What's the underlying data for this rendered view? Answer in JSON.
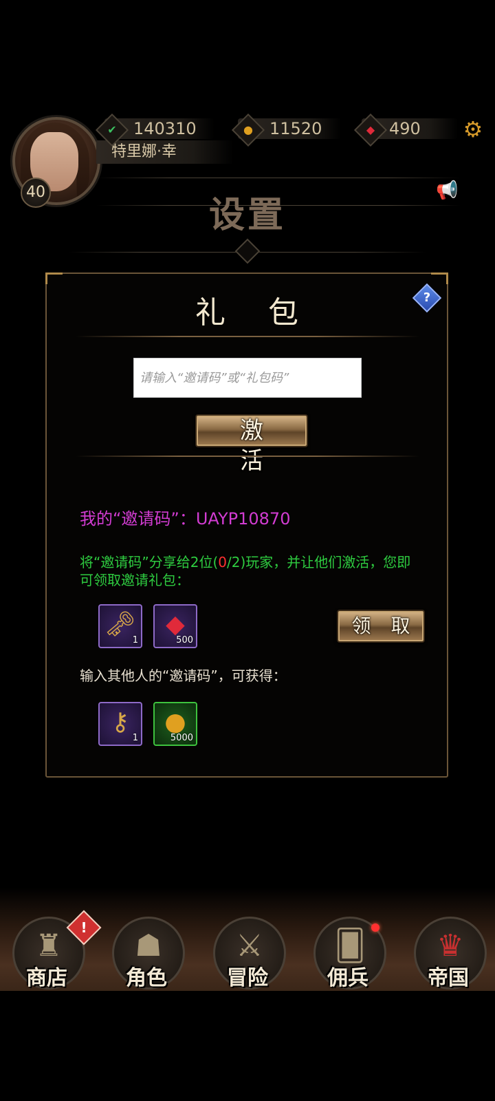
{
  "header": {
    "level": "40",
    "player_name": "特里娜·幸",
    "resources": [
      {
        "icon": "green-feather-icon",
        "value": "140310"
      },
      {
        "icon": "gold-coin-icon",
        "value": "11520"
      },
      {
        "icon": "red-gem-icon",
        "value": "490"
      }
    ]
  },
  "page_title": "设置",
  "panel": {
    "title": "礼 包",
    "code_input_placeholder": "请输入“邀请码”或“礼包码”",
    "activate_label": "激 活",
    "invite_code_line": "我的“邀请码”：UAYP10870",
    "share_text_before": "将“邀请码”分享给2位(",
    "share_progress_current": "0",
    "share_text_after": "/2)玩家，并让他们激活，您即可领取邀请礼包：",
    "invite_rewards": [
      {
        "icon": "key-bundle-icon",
        "count": "1"
      },
      {
        "icon": "red-gem-icon",
        "count": "500"
      }
    ],
    "claim_label": "领 取",
    "enter_others_text": "输入其他人的“邀请码”，可获得：",
    "enter_rewards": [
      {
        "icon": "key-icon",
        "count": "1"
      },
      {
        "icon": "gold-coin-icon",
        "count": "5000"
      }
    ]
  },
  "nav": {
    "items": [
      {
        "label": "商店",
        "icon": "castle-icon"
      },
      {
        "label": "角色",
        "icon": "hooded-figure-icon"
      },
      {
        "label": "冒险",
        "icon": "crossed-swords-icon"
      },
      {
        "label": "佣兵",
        "icon": "cards-icon"
      },
      {
        "label": "帝国",
        "icon": "crown-icon"
      }
    ],
    "shop_alert": "!"
  },
  "colors": {
    "invite_code": "#d23cd2",
    "share_text": "#2ecc40",
    "progress_red": "#ff3030",
    "panel_border": "#6b5538"
  }
}
